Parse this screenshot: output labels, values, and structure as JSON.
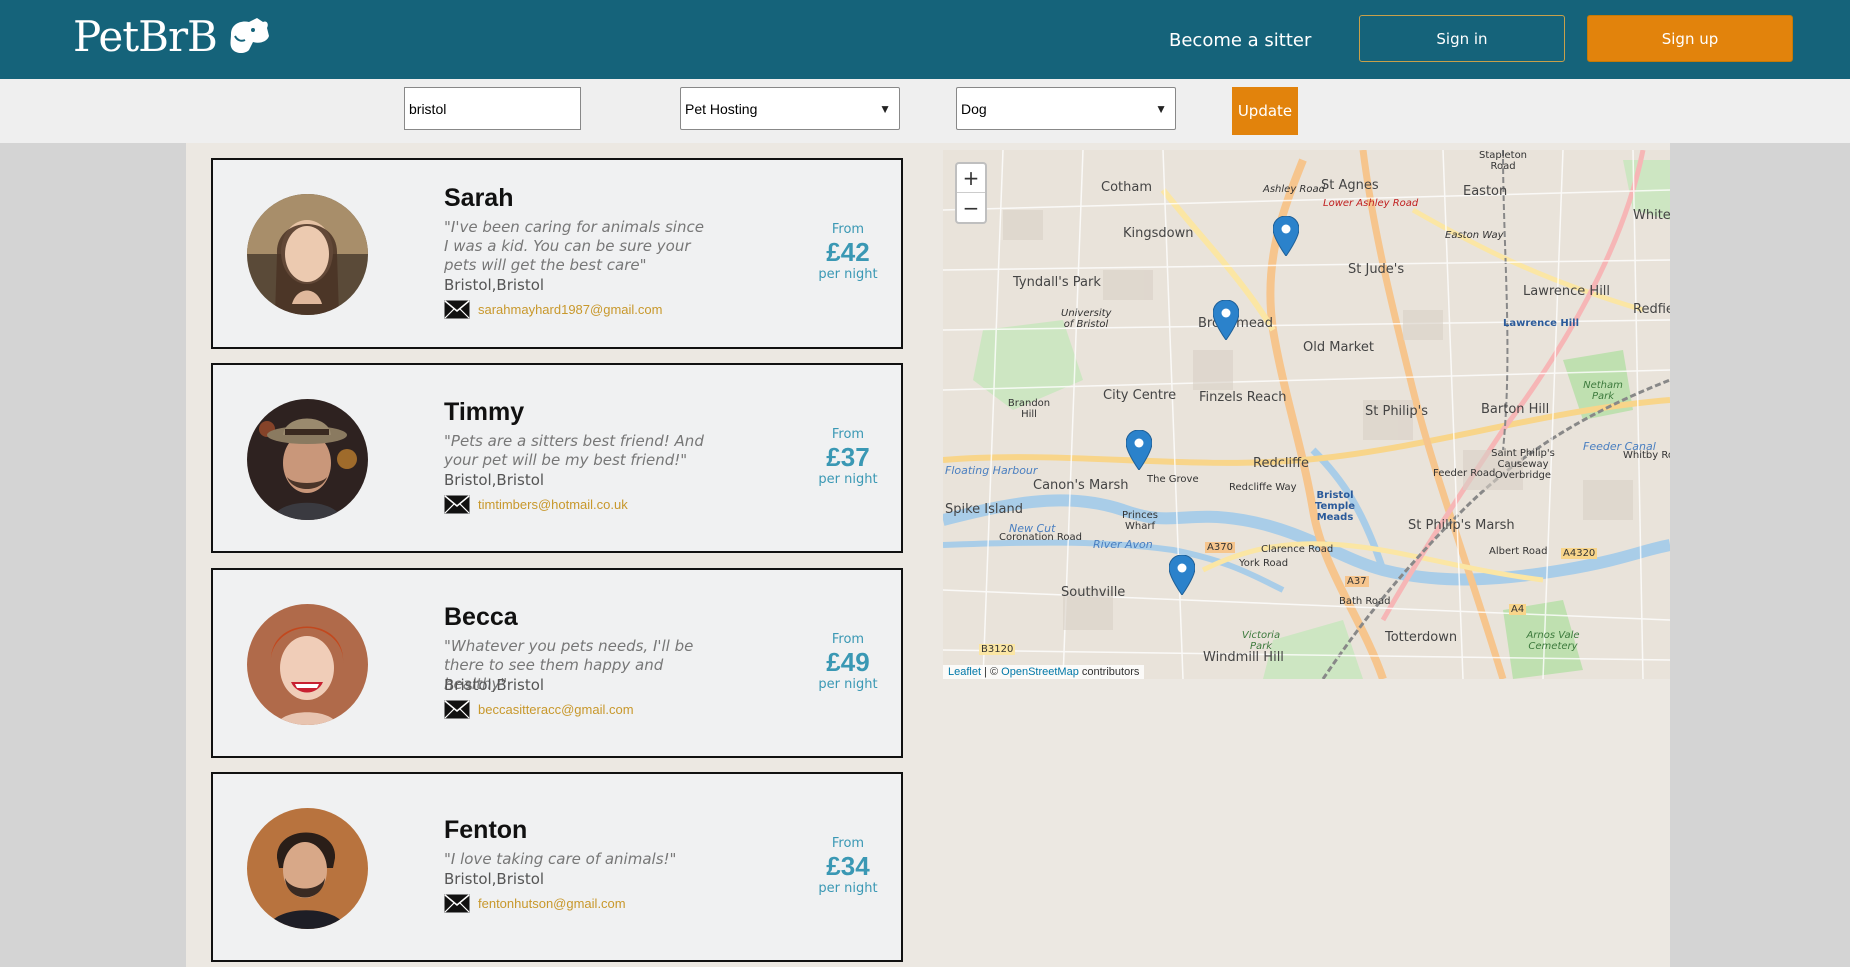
{
  "header": {
    "logo_text": "PetBrB",
    "logo_icon": "dog-icon",
    "become_sitter": "Become a sitter",
    "sign_in": "Sign in",
    "sign_up": "Sign up"
  },
  "filters": {
    "location_value": "bristol",
    "service_selected": "Pet Hosting",
    "pet_selected": "Dog",
    "update_label": "Update"
  },
  "sitters": [
    {
      "name": "Sarah",
      "quote": "\"I've been caring for animals since I was a kid. You can be sure your pets will get the best care\"",
      "location": "Bristol,Bristol",
      "email": "sarahmayhard1987@gmail.com",
      "from": "From",
      "price": "£42",
      "per": "per night"
    },
    {
      "name": "Timmy",
      "quote": "\"Pets are a sitters best friend! And your pet will be my best friend!\"",
      "location": "Bristol,Bristol",
      "email": "timtimbers@hotmail.co.uk",
      "from": "From",
      "price": "£37",
      "per": "per night"
    },
    {
      "name": "Becca",
      "quote": "\"Whatever you pets needs, I'll be there to see them happy and healthy\"",
      "location": "Bristol,Bristol",
      "email": "beccasitteracc@gmail.com",
      "from": "From",
      "price": "£49",
      "per": "per night"
    },
    {
      "name": "Fenton",
      "quote": "\"I love taking care of animals!\"",
      "location": "Bristol,Bristol",
      "email": "fentonhutson@gmail.com",
      "from": "From",
      "price": "£34",
      "per": "per night"
    }
  ],
  "map": {
    "zoom_in": "+",
    "zoom_out": "−",
    "attribution_leaflet": "Leaflet",
    "attribution_sep": " | © ",
    "attribution_osm": "OpenStreetMap",
    "attribution_suffix": " contributors",
    "labels": [
      "Cotham",
      "Kingsdown",
      "Tyndall's Park",
      "St Agnes",
      "Easton",
      "St Jude's",
      "Lawrence Hill",
      "Old Market",
      "Broadmead",
      "City Centre",
      "Finzels Reach",
      "St Philip's",
      "Barton Hill",
      "Redcliffe",
      "Canon's Marsh",
      "Spike Island",
      "Southville",
      "Totterdown",
      "St Philip's Marsh",
      "Saint Philip's Causeway Overbridge",
      "Brandon Hill",
      "Princes Wharf",
      "Stapleton Road",
      "Redfie",
      "White",
      "Windmill Hill",
      "Victoria Park",
      "Netham Park",
      "Arnos Vale Cemetery",
      "Bristol Temple Meads",
      "The Grove",
      "Redcliffe Way",
      "A370",
      "A37",
      "A4320",
      "A4",
      "B3120",
      "University of Bristol",
      "Coronation Road",
      "River Avon",
      "New Cut",
      "Feeder Road",
      "Albert Road",
      "Bath Road",
      "Whitby Road",
      "York Road",
      "Clarence Road",
      "Lower Ashley Road",
      "Ashley Road",
      "Easton Way",
      "Lawrence Hill",
      "Feeder Canal",
      "Floating Harbour"
    ],
    "marker_icon": "map-marker-icon"
  },
  "colors": {
    "header_bg": "#15637a",
    "accent_orange": "#e2830c",
    "price_teal": "#3a98b4",
    "email_gold": "#c8982c"
  }
}
